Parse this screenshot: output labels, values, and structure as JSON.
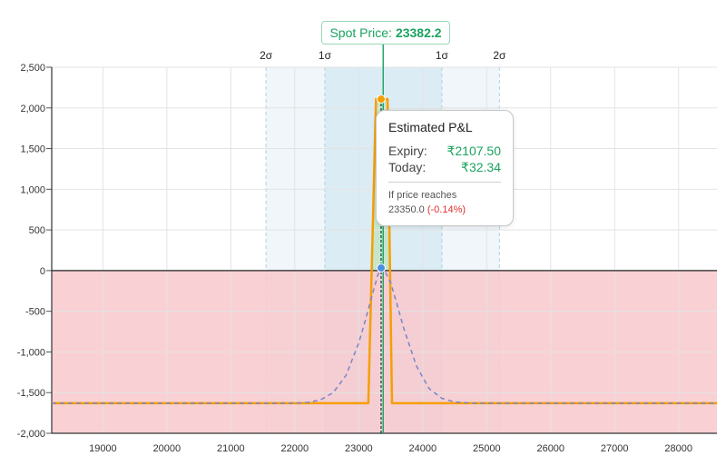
{
  "chart_data": {
    "type": "area",
    "title": "",
    "xlabel": "",
    "ylabel": "",
    "xlim": [
      18200,
      28600
    ],
    "ylim": [
      -2000,
      2500
    ],
    "x_ticks": [
      19000,
      20000,
      21000,
      22000,
      23000,
      24000,
      25000,
      26000,
      27000,
      28000
    ],
    "y_ticks": [
      -2000,
      -1500,
      -1000,
      -500,
      0,
      500,
      1000,
      1500,
      2000,
      2500
    ],
    "y_tick_labels": [
      "-2,000",
      "-1,500",
      "-1,000",
      "-500",
      "0",
      "500",
      "1,000",
      "1,500",
      "2,000",
      "2,500"
    ],
    "grid": true,
    "series": [
      {
        "kind": "expiry",
        "color": "#f59f00",
        "x": [
          18200,
          23150,
          23270,
          23450,
          23520,
          28600
        ],
        "y": [
          -1630,
          -1630,
          2107.5,
          2107.5,
          -1630,
          -1630
        ]
      },
      {
        "kind": "today",
        "color": "#7c83c9",
        "style": "dashed",
        "x": [
          18200,
          22000,
          22200,
          22400,
          22600,
          22800,
          23000,
          23100,
          23200,
          23300,
          23350,
          23400,
          23500,
          23600,
          23700,
          23900,
          24100,
          24300,
          24500,
          24800,
          28600
        ],
        "y": [
          -1630,
          -1630,
          -1620,
          -1590,
          -1500,
          -1290,
          -890,
          -620,
          -330,
          -50,
          32,
          10,
          -150,
          -420,
          -700,
          -1170,
          -1450,
          -1570,
          -1615,
          -1630,
          -1630
        ]
      }
    ],
    "profit_zone_color": "#c3e6c8",
    "loss_zone_color": "#f8c9cc",
    "spot": {
      "label": "Spot Price:",
      "value": "23382.2",
      "x": 23382.2,
      "color": "#1aa35f"
    },
    "selected_x": 23350,
    "sigma_bands": [
      {
        "label": "2σ",
        "lo": 21550,
        "hi": 25200
      },
      {
        "label": "1σ",
        "lo": 22470,
        "hi": 24300
      }
    ],
    "tooltip": {
      "title": "Estimated P&L",
      "expiry_label": "Expiry:",
      "expiry_value": "₹2107.50",
      "today_label": "Today:",
      "today_value": "₹32.34",
      "reach_label": "If price reaches",
      "reach_price": "23350.0",
      "reach_change": "(-0.14%)"
    }
  }
}
